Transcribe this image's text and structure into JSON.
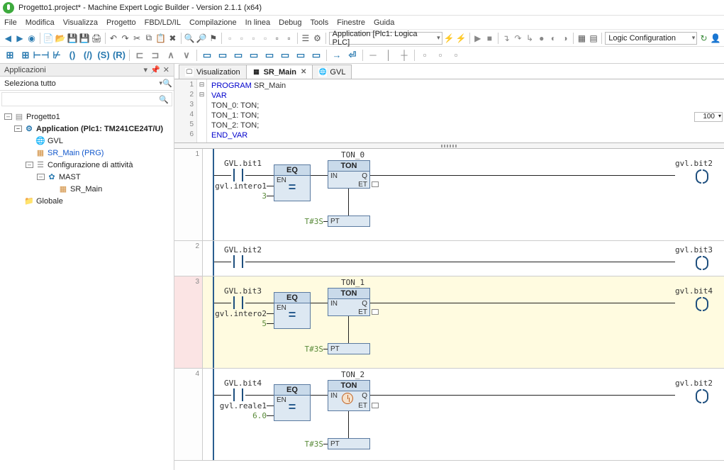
{
  "title": "Progetto1.project* - Machine Expert Logic Builder - Version 2.1.1 (x64)",
  "menu": [
    "File",
    "Modifica",
    "Visualizza",
    "Progetto",
    "FBD/LD/IL",
    "Compilazione",
    "In linea",
    "Debug",
    "Tools",
    "Finestre",
    "Guida"
  ],
  "toolbar": {
    "app_combo": "Application [Plc1: Logica PLC]",
    "logic_combo": "Logic Configuration"
  },
  "sidebar": {
    "title": "Applicazioni",
    "select_all": "Seleziona tutto",
    "tree": [
      {
        "l": "Progetto1",
        "lvl": 0,
        "tw": "–",
        "ico": "i-prj",
        "glyph": "▤"
      },
      {
        "l": "Application (Plc1: TM241CE24T/U)",
        "lvl": 1,
        "tw": "–",
        "ico": "i-gear",
        "glyph": "⚙",
        "bold": true
      },
      {
        "l": "GVL",
        "lvl": 2,
        "ico": "i-globe",
        "glyph": "🌐"
      },
      {
        "l": "SR_Main (PRG)",
        "lvl": 2,
        "ico": "i-doc",
        "glyph": "▦",
        "sel": true
      },
      {
        "l": "Configurazione di attività",
        "lvl": 2,
        "tw": "–",
        "ico": "i-tsk",
        "glyph": "☰"
      },
      {
        "l": "MAST",
        "lvl": 3,
        "tw": "–",
        "ico": "i-gear",
        "glyph": "✿"
      },
      {
        "l": "SR_Main",
        "lvl": 4,
        "ico": "i-doc",
        "glyph": "▦"
      },
      {
        "l": "Globale",
        "lvl": 1,
        "ico": "i-fld",
        "glyph": "📁"
      }
    ]
  },
  "tabs": [
    {
      "label": "Visualization",
      "ico": "🖵"
    },
    {
      "label": "SR_Main",
      "ico": "▦",
      "active": true,
      "close": true
    },
    {
      "label": "GVL",
      "ico": "🌐"
    }
  ],
  "code": {
    "lines": [
      "1",
      "2",
      "3",
      "4",
      "5",
      "6"
    ],
    "l1_a": "PROGRAM",
    "l1_b": " SR_Main",
    "l2": "VAR",
    "l3": "    TON_0: TON;",
    "l4": "    TON_1: TON;",
    "l5": "    TON_2: TON;",
    "l6": "END_VAR",
    "zoom": "100"
  },
  "rungs": {
    "r1": {
      "no": "1",
      "in_top": "GVL.bit1",
      "in_mid": "gvl.intero1",
      "in_bot": "3",
      "eq": "EQ",
      "eq_sym": "=",
      "eq_en": "EN",
      "ton": "TON_0",
      "ton_t": "TON",
      "in": "IN",
      "q": "Q",
      "et": "ET",
      "pt": "PT",
      "t": "T#3S",
      "out": "gvl.bit2"
    },
    "r2": {
      "no": "2",
      "in": "GVL.bit2",
      "out": "gvl.bit3"
    },
    "r3": {
      "no": "3",
      "in_top": "GVL.bit3",
      "in_mid": "gvl.intero2",
      "in_bot": "5",
      "eq": "EQ",
      "eq_sym": "=",
      "eq_en": "EN",
      "ton": "TON_1",
      "ton_t": "TON",
      "in": "IN",
      "q": "Q",
      "et": "ET",
      "pt": "PT",
      "t": "T#3S",
      "out": "gvl.bit4"
    },
    "r4": {
      "no": "4",
      "in_top": "GVL.bit4",
      "in_mid": "gvl.reale1",
      "in_bot": "6.0",
      "eq": "EQ",
      "eq_sym": "=",
      "eq_en": "EN",
      "ton": "TON_2",
      "ton_t": "TON",
      "in": "IN",
      "q": "Q",
      "et": "ET",
      "pt": "PT",
      "t": "T#3S",
      "out": "gvl.bit2"
    }
  }
}
